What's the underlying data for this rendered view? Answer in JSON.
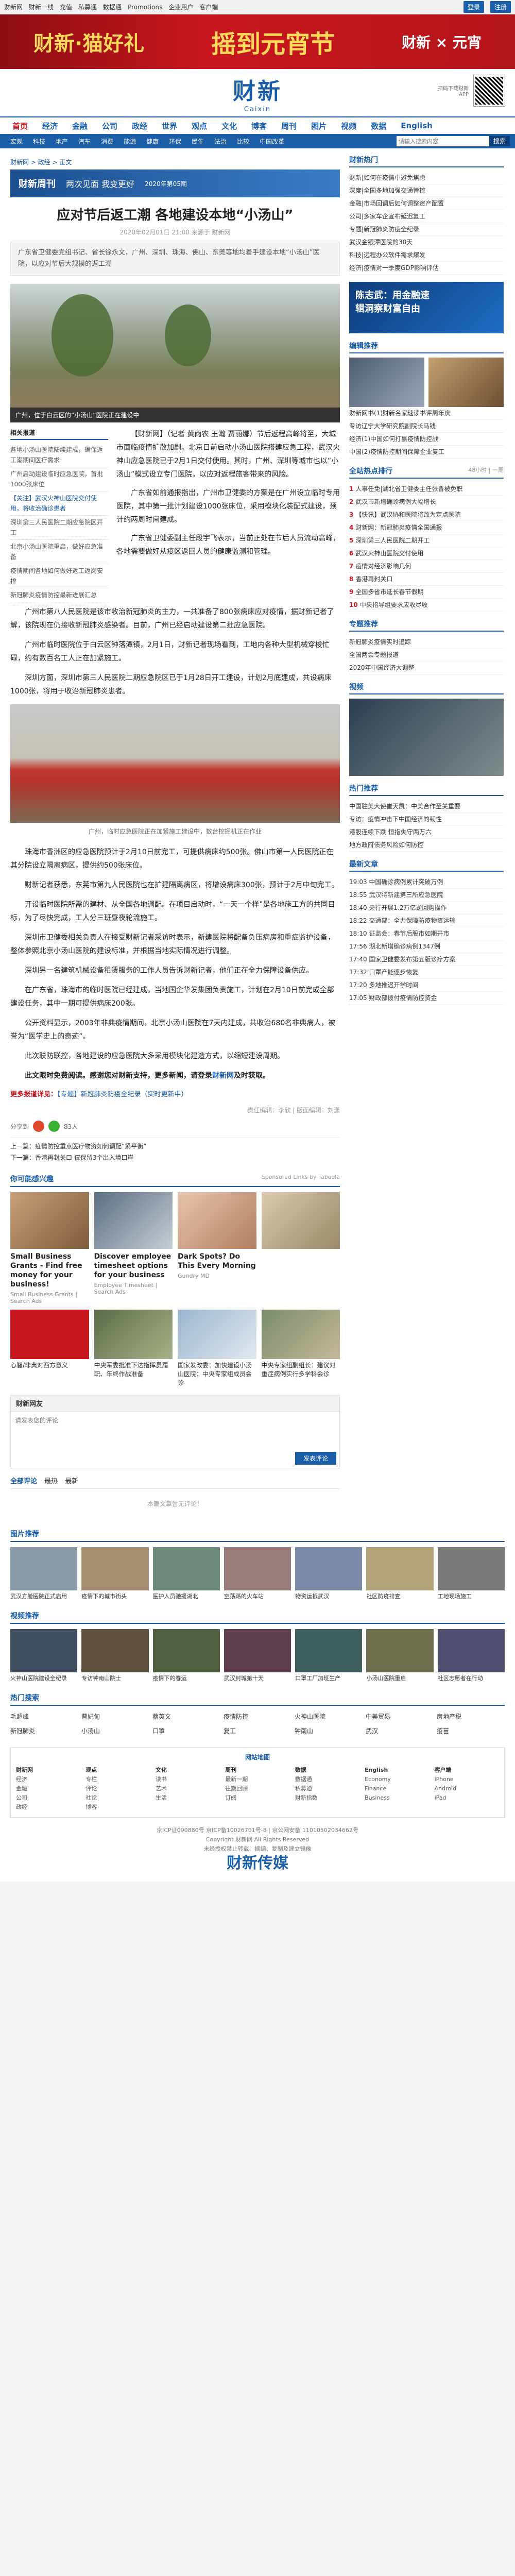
{
  "top": {
    "links": [
      "财新网",
      "财新一线",
      "充值",
      "私募通",
      "数据通",
      "Promotions",
      "企业用户",
      "客户端"
    ],
    "login": "登录",
    "register": "注册"
  },
  "banner": {
    "a": "财新·猫好礼",
    "b": "摇到元宵节",
    "c": "财新 × 元宵"
  },
  "logo": {
    "title": "财新",
    "sub": "Caixin",
    "qr_text": "扫码下载财新APP"
  },
  "nav1": [
    "首页",
    "经济",
    "金融",
    "公司",
    "政经",
    "世界",
    "观点",
    "文化",
    "博客",
    "周刊",
    "图片",
    "视频",
    "数据",
    "English"
  ],
  "nav2": [
    "宏观",
    "科技",
    "地产",
    "汽车",
    "消费",
    "能源",
    "健康",
    "环保",
    "民生",
    "法治",
    "比较",
    "中国改革",
    "中国改革"
  ],
  "search": {
    "placeholder": "请输入搜索内容",
    "button": "搜索"
  },
  "crumb": "财新网 > 政经 > 正文",
  "weekly": {
    "a": "财新周刊",
    "b": "两次见面 我变更好",
    "c": "2020年第05期"
  },
  "article": {
    "title": "应对节后返工潮 各地建设本地“小汤山”",
    "meta": "2020年02月01日 21:00 来源于 财新网",
    "summary": "广东省卫健委党组书记、省长徐永文，广州、深圳、珠海、佛山、东莞等地均着手建设本地“小汤山”医院，以应对节后大规模的返工潮",
    "photo_caption": "广州，位于白云区的“小汤山”医院正在建设中",
    "p1": "【财新网】（记者 黄雨农 王瀚 贾丽娜）节后返程高峰将至，大城市面临疫情扩散加剧。北京日前启动小汤山医院搭建应急工程，武汉火神山应急医院已于2月1日交付使用。其时，广州、深圳等城市也以“小汤山”模式设立专门医院，以应对返程旅客带来的风险。",
    "p2": "广东省如前通报指出，广州市卫健委的方案是在广州设立临时专用医院，其中第一批计划建设1000张床位，采用模块化装配式建设，预计约两周时间建成。",
    "p3": "广东省卫健委副主任段宇飞表示，当前正处在节后人员流动高峰，各地需要做好从疫区返回人员的健康监测和管理。",
    "p4": "广州市第八人民医院是该市收治新冠肺炎的主力，一共准备了800张病床应对疫情，据财新记者了解，该院现在仍接收新冠肺炎感染者。目前，广州已经启动建设第二批应急医院。",
    "p5": "广州市临时医院位于白云区钟落潭镇，2月1日，财新记者现场看到，工地内各种大型机械穿梭忙碌，约有数百名工人正在加紧施工。",
    "p6": "深圳方面，深圳市第三人民医院二期应急院区已于1月28日开工建设，计划2月底建成，共设病床1000张，将用于收治新冠肺炎患者。",
    "photo2_caption": "广州，临时应急医院正在加紧施工建设中，数台挖掘机正在作业",
    "p7": "珠海市香洲区的应急医院预计于2月10日前完工，可提供病床约500张。佛山市第一人民医院正在其分院设立隔离病区，提供约500张床位。",
    "p8": "财新记者获悉，东莞市第九人民医院也在扩建隔离病区，将增设病床300张，预计于2月中旬完工。",
    "p9": "开设临时医院所需的建材、从全国各地调配。在项目启动时，“一天一个样”是各地施工方的共同目标，为了尽快完成，工人分三班昼夜轮流施工。",
    "p10": "深圳市卫健委相关负责人在接受财新记者采访时表示，新建医院将配备负压病房和重症监护设备，整体参照北京小汤山医院的建设标准，并根据当地实际情况进行调整。",
    "p11": "深圳另一名建筑机械设备租赁服务的工作人员告诉财新记者，他们正在全力保障设备供应。",
    "p12": "在广东省，珠海市的临时医院已经建成，当地国企华发集团负责施工，计划在2月10日前完成全部建设任务，其中一期可提供病床200张。",
    "p13": "公开资料显示，2003年非典疫情期间，北京小汤山医院在7天内建成，共收治680名非典病人，被誉为“医学史上的奇迹”。",
    "p14": "此次联防联控，各地建设的应急医院大多采用模块化建造方式，以缩短建设周期。",
    "more_bold": "此文限时免费阅读。感谢您对财新支持，更多新闻，请登录",
    "more_link": "财新网",
    "more_tail": "及时获取。",
    "more_topic_label": "更多报道详见：",
    "more_topic": "【专题】新冠肺炎防疫全纪录（实时更新中）",
    "editor": "责任编辑：李欣 | 版面编辑：刘潇"
  },
  "aside": {
    "head": "相关报道",
    "items": [
      "各地小汤山医院陆续建成，确保返工潮期间医疗需求",
      "广州启动建设临时应急医院，首批1000张床位",
      "【关注】武汉火神山医院交付使用，将收治确诊患者",
      "深圳第三人民医院二期应急院区开工",
      "北京小汤山医院重启，做好应急准备",
      "疫情期间各地如何做好返工返岗安排",
      "新冠肺炎疫情防控最新进展汇总"
    ]
  },
  "share": {
    "label": "分享到",
    "count": "83人"
  },
  "prevnext": {
    "prev": "上一篇：疫情防控重点医疗物资如何调配“紧平衡”",
    "next": "下一篇：香港再封关口 仅保留3个出入境口岸"
  },
  "ads": {
    "head": "你可能感兴趣",
    "sponsor": "Sponsored Links by Taboola",
    "items": [
      {
        "t": "Small Business Grants - Find free money for your business!",
        "s": "Small Business Grants | Search Ads"
      },
      {
        "t": "Discover employee timesheet options for your business",
        "s": "Employee Timesheet | Search Ads"
      },
      {
        "t": "Dark Spots? Do This Every Morning",
        "s": "Gundry MD"
      },
      {
        "t": "",
        "s": ""
      }
    ]
  },
  "cards": [
    {
      "t": "心智/非典对西方意义"
    },
    {
      "t": "中央军委批准下达指挥员履职、年终作战准备"
    },
    {
      "t": "国家发改委：加快建设小汤山医院；中央专家组成员会诊"
    },
    {
      "t": "中央专家组副组长：建议对重症病例实行多学科会诊"
    }
  ],
  "comment": {
    "head": "财新网友",
    "placeholder": "请发表您的评论",
    "submit": "发表评论"
  },
  "tabs": [
    "全部评论",
    "最热",
    "最新"
  ],
  "nocomment": "本篇文章暂无评论！",
  "right": {
    "box1": {
      "head": "财新热门",
      "items": [
        "财新|如何在疫情中避免焦虑",
        "深度|全国多地加强交通管控",
        "金融|市场回调后如何调整资产配置",
        "公司|多家车企宣布延迟复工",
        "专题|新冠肺炎防疫全纪录",
        "武汉金银潭医院的30天",
        "科技|远程办公软件需求爆发",
        "经济|疫情对一季度GDP影响评估"
      ]
    },
    "ad1": {
      "title": "陈志武：用金融速",
      "sub": "辑洞察财富自由"
    },
    "box2": {
      "head": "编辑推荐",
      "items": [
        "财新网书(1)财新名家速读书评周年庆",
        "专访辽宁大学研究院副院长马钱",
        "经济(1)中国如何打赢疫情防控战",
        "中国(2)疫情防控期间保障企业复工"
      ]
    },
    "box3": {
      "head": "全站热点排行",
      "tab1": "48小时",
      "tab2": "一周",
      "items": [
        "人事任免|湖北省卫健委主任张晋被免职",
        "武汉市新增确诊病例大幅增长",
        "【快讯】武汉协和医院将改为定点医院",
        "财新网：新冠肺炎疫情全国通报",
        "深圳第三人民医院二期开工",
        "武汉火神山医院交付使用",
        "疫情对经济影响几何",
        "香港再封关口",
        "全国多省市延长春节假期",
        "中央指导组要求应收尽收"
      ]
    },
    "box4": {
      "head": "专题推荐",
      "items": [
        "新冠肺炎疫情实时追踪",
        "全国两会专题报道",
        "2020年中国经济大调整"
      ]
    },
    "box5": {
      "head": "热门推荐",
      "items": [
        "中国驻美大使崔天凯：中美合作至关重要",
        "专访：疫情冲击下中国经济的韧性",
        "港股连续下跌 恒指失守两万六",
        "地方政府债务风险如何防控"
      ]
    },
    "box6": {
      "head": "最新文章",
      "items": [
        "19:03 中国确诊病例累计突破万例",
        "18:55 武汉将新建第三所应急医院",
        "18:40 央行开展1.2万亿逆回购操作",
        "18:22 交通部：全力保障防疫物资运输",
        "18:10 证监会：春节后股市如期开市",
        "17:56 湖北新增确诊病例1347例",
        "17:40 国家卫健委发布第五版诊疗方案",
        "17:32 口罩产能逐步恢复",
        "17:20 多地推迟开学时间",
        "17:05 财政部拨付疫情防控资金"
      ]
    }
  },
  "pics": {
    "head": "图片推荐",
    "items": [
      "武汉方舱医院正式启用",
      "疫情下的城市街头",
      "医护人员驰援湖北",
      "空荡荡的火车站",
      "物资运抵武汉",
      "社区防疫排查",
      "工地现场施工"
    ]
  },
  "video": {
    "head": "视频推荐",
    "items": [
      "火神山医院建设全纪录",
      "专访钟南山院士",
      "疫情下的春运",
      "武汉封城第十天",
      "口罩工厂加班生产",
      "小汤山医院重启",
      "社区志愿者在行动"
    ]
  },
  "hot": {
    "head": "热门搜索",
    "items": [
      "毛超峰",
      "曹妃甸",
      "蔡英文",
      "疫情防控",
      "火神山医院",
      "中美贸易",
      "房地产税",
      "新冠肺炎",
      "小汤山",
      "口罩",
      "复工",
      "钟南山",
      "武汉",
      "疫苗"
    ]
  },
  "sitemap": {
    "head": "网站地图",
    "cols": [
      {
        "h": "财新网",
        "i": [
          "经济",
          "金融",
          "公司",
          "政经"
        ]
      },
      {
        "h": "观点",
        "i": [
          "专栏",
          "评论",
          "社论",
          "博客"
        ]
      },
      {
        "h": "文化",
        "i": [
          "读书",
          "艺术",
          "生活"
        ]
      },
      {
        "h": "周刊",
        "i": [
          "最新一期",
          "往期回顾",
          "订阅"
        ]
      },
      {
        "h": "数据",
        "i": [
          "数据通",
          "私募通",
          "财新指数"
        ]
      },
      {
        "h": "English",
        "i": [
          "Economy",
          "Finance",
          "Business"
        ]
      },
      {
        "h": "客户端",
        "i": [
          "iPhone",
          "Android",
          "iPad"
        ]
      }
    ]
  },
  "footer": {
    "l1": "京ICP证090880号 京ICP备10026701号-8 | 京公网安备 11010502034662号",
    "l2": "Copyright 财新网 All Rights Reserved",
    "l3": "未经授权禁止转载、摘编、复制及建立镜像",
    "logo": "财新传媒"
  }
}
